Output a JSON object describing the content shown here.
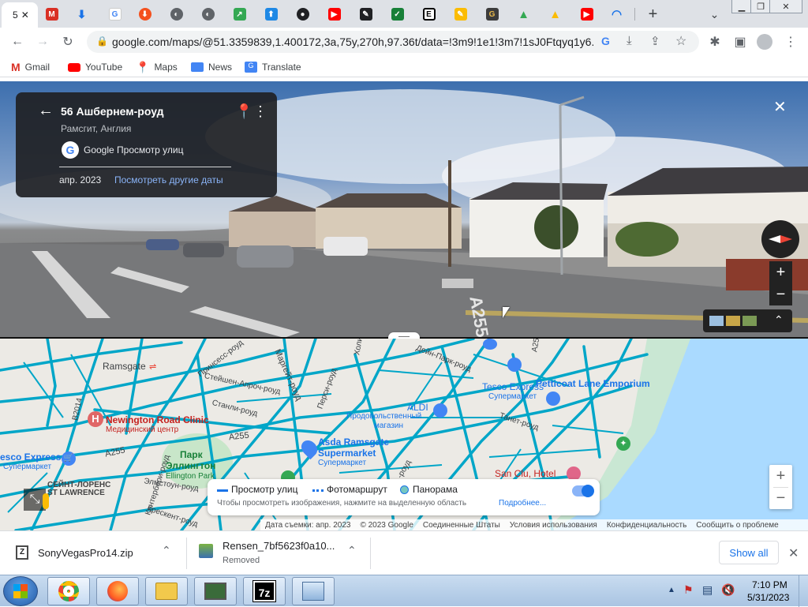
{
  "browser": {
    "active_tab_title": "5",
    "url": "google.com/maps/@51.3359839,1.400172,3a,75y,270h,97.36t/data=!3m9!1e1!3m7!1sJ0Ftqyq1y6...",
    "new_tab_label": "+",
    "bookmarks": [
      {
        "label": "Gmail",
        "icon": "gmail-icon"
      },
      {
        "label": "YouTube",
        "icon": "youtube-icon"
      },
      {
        "label": "Maps",
        "icon": "maps-icon"
      },
      {
        "label": "News",
        "icon": "news-icon"
      },
      {
        "label": "Translate",
        "icon": "translate-icon"
      }
    ]
  },
  "streetview": {
    "address": "56 Ашбернем-роуд",
    "region": "Рамсгит, Англия",
    "provider": "Google Просмотр улиц",
    "date": "апр. 2023",
    "other_dates_link": "Посмотреть другие даты",
    "road_marking": "A255"
  },
  "map": {
    "labels": {
      "ramsgate": "Ramsgate",
      "princess": "Принсесс-роуд",
      "stephen": "Стейшен-Апроч-роуд",
      "stanley": "Станли-роуд",
      "margate": "Маргейт-роуд",
      "percy": "Перси-роуд",
      "holly": "Холи",
      "dane_park": "Дейн-Парк-роуд",
      "b2014": "B2014",
      "a255_1": "A255",
      "a255_2": "A255",
      "a255_3": "A255",
      "canterbury": "Кентербери-роуд",
      "crescent": "Крескент-роуд",
      "st_lawrence_ru": "СЕЙНТ-ЛОРЕНС",
      "st_lawrence_en": "ST LAWRENCE",
      "tanet": "Танет-роуд",
      "elmstone": "Элмстоун-роуд",
      "road_e": "-роуд"
    },
    "pois": {
      "newington": {
        "name": "Newington Road Clinic",
        "sub": "Медицинский центр"
      },
      "park": {
        "name": "Парк",
        "name2": "Эллингтон",
        "sub": "Ellington Park"
      },
      "tesco_w": {
        "name": "esco Express",
        "sub": "Супермаркет"
      },
      "asda": {
        "name": "Asda Ramsgate",
        "name2": "Supermarket",
        "sub": "Супермаркет"
      },
      "aldi": {
        "name": "ALDI",
        "sub": "Продовольственный",
        "sub2": "магазин"
      },
      "tesco_e": {
        "name": "Tesco Express",
        "sub": "Супермаркет"
      },
      "petticoat": {
        "name": "Petticoat Lane Emporium"
      },
      "sanclu": {
        "name": "San Clu, Hotel"
      }
    },
    "layers": {
      "street_view": "Просмотр улиц",
      "photo_route": "Фотомаршрут",
      "panorama": "Панорама",
      "hint": "Чтобы просмотреть изображения, нажмите на выделенную область",
      "more": "Подробнее..."
    },
    "attribution": [
      "Дата съемки: апр. 2023",
      "© 2023 Google",
      "Соединенные Штаты",
      "Условия использования",
      "Конфиденциальность",
      "Сообщить о проблеме"
    ]
  },
  "downloads": {
    "items": [
      {
        "name": "SonyVegasPro14.zip",
        "status": ""
      },
      {
        "name": "Rensen_7bf5623f0a10...",
        "status": "Removed"
      }
    ],
    "show_all": "Show all"
  },
  "taskbar": {
    "time": "7:10 PM",
    "date": "5/31/2023"
  },
  "colors": {
    "road_network": "#00a6c8",
    "link": "#8ab4f8",
    "map_link": "#1a73e8",
    "water": "#aadaff"
  }
}
